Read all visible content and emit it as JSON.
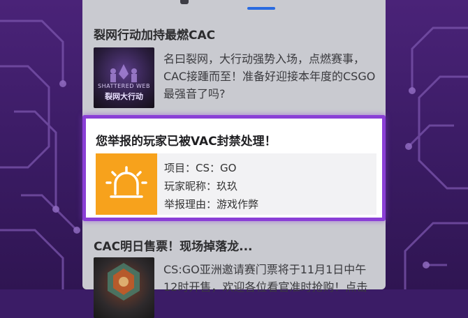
{
  "article1": {
    "title": "裂网行动加持最燃CAC",
    "thumb_line1": "SHATTERED WEB",
    "thumb_line2": "裂网大行动",
    "desc": "名曰裂网，大行动强势入场，点燃赛事，CAC接踵而至！准备好迎接本年度的CSGO最强音了吗?"
  },
  "notice": {
    "heading": "您举报的玩家已被VAC封禁处理！",
    "icon": "alarm-light-icon",
    "rows": [
      "项目：CS：GO",
      "玩家昵称：玖玖",
      "举报理由：游戏作弊"
    ]
  },
  "article2": {
    "title": "CAC明日售票！现场掉落龙...",
    "desc": "CS:GO亚洲邀请赛门票将于11月1日中午12时开售，欢迎各位看官准时抢购！点击"
  },
  "colors": {
    "highlight_border": "#8a3fd6",
    "icon_bg": "#f7a21c",
    "tab_indicator": "#2a6be0"
  }
}
